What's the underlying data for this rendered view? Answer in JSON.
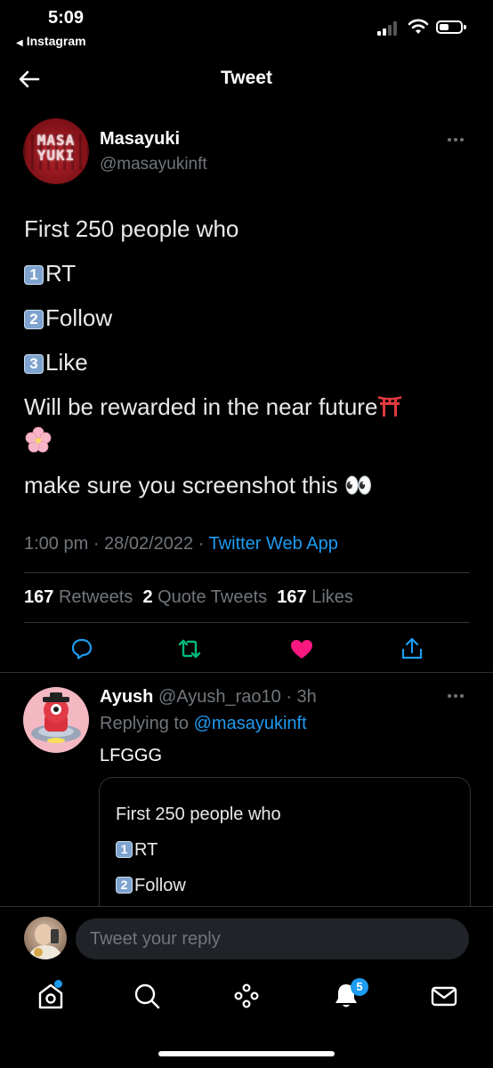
{
  "status_bar": {
    "time": "5:09",
    "back_app": "Instagram"
  },
  "header": {
    "title": "Tweet"
  },
  "tweet": {
    "author_name": "Masayuki",
    "author_handle": "@masayukinft",
    "avatar_text_line1": "MASA",
    "avatar_text_line2": "YUKI",
    "lines": {
      "l1": "First 250 people who",
      "l2_num": "1",
      "l2": "RT",
      "l3_num": "2",
      "l3": "Follow",
      "l4_num": "3",
      "l4": "Like",
      "l5": "Will be rewarded in the near future",
      "l7": "make sure you screenshot this",
      "eyes": "👀",
      "blossom": "🌸"
    },
    "timestamp": "1:00 pm · 28/02/2022 ·",
    "source": "Twitter Web App",
    "retweets_count": "167",
    "retweets_label": "Retweets",
    "quotes_count": "2",
    "quotes_label": "Quote Tweets",
    "likes_count": "167",
    "likes_label": "Likes",
    "liked": true
  },
  "reply": {
    "name": "Ayush",
    "handle_time": "@Ayush_rao10 · 3h",
    "replying_prefix": "Replying to",
    "replying_handle": "@masayukinft",
    "text": "LFGGG",
    "quote_lines": {
      "q1": "First 250 people who",
      "q2_num": "1",
      "q2": "RT",
      "q3_num": "2",
      "q3": "Follow"
    }
  },
  "composer": {
    "placeholder": "Tweet your reply"
  },
  "tabbar": {
    "notifications_badge": "5"
  },
  "colors": {
    "accent": "#1d9bf0",
    "like": "#f91880",
    "retweet": "#00ba7c",
    "muted": "#71767b"
  }
}
